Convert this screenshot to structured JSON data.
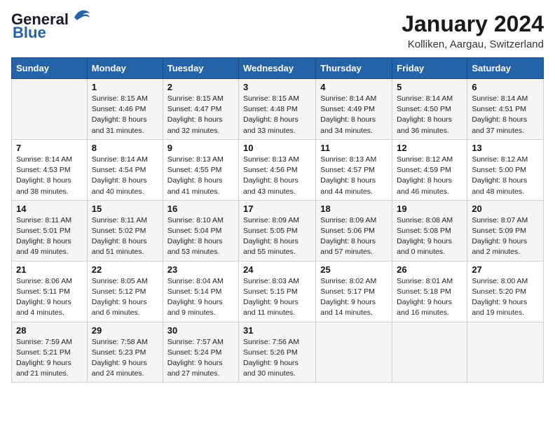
{
  "header": {
    "logo_line1": "General",
    "logo_line2": "Blue",
    "title": "January 2024",
    "subtitle": "Kolliken, Aargau, Switzerland"
  },
  "calendar": {
    "days_of_week": [
      "Sunday",
      "Monday",
      "Tuesday",
      "Wednesday",
      "Thursday",
      "Friday",
      "Saturday"
    ],
    "weeks": [
      [
        {
          "day": "",
          "info": ""
        },
        {
          "day": "1",
          "info": "Sunrise: 8:15 AM\nSunset: 4:46 PM\nDaylight: 8 hours\nand 31 minutes."
        },
        {
          "day": "2",
          "info": "Sunrise: 8:15 AM\nSunset: 4:47 PM\nDaylight: 8 hours\nand 32 minutes."
        },
        {
          "day": "3",
          "info": "Sunrise: 8:15 AM\nSunset: 4:48 PM\nDaylight: 8 hours\nand 33 minutes."
        },
        {
          "day": "4",
          "info": "Sunrise: 8:14 AM\nSunset: 4:49 PM\nDaylight: 8 hours\nand 34 minutes."
        },
        {
          "day": "5",
          "info": "Sunrise: 8:14 AM\nSunset: 4:50 PM\nDaylight: 8 hours\nand 36 minutes."
        },
        {
          "day": "6",
          "info": "Sunrise: 8:14 AM\nSunset: 4:51 PM\nDaylight: 8 hours\nand 37 minutes."
        }
      ],
      [
        {
          "day": "7",
          "info": "Sunrise: 8:14 AM\nSunset: 4:53 PM\nDaylight: 8 hours\nand 38 minutes."
        },
        {
          "day": "8",
          "info": "Sunrise: 8:14 AM\nSunset: 4:54 PM\nDaylight: 8 hours\nand 40 minutes."
        },
        {
          "day": "9",
          "info": "Sunrise: 8:13 AM\nSunset: 4:55 PM\nDaylight: 8 hours\nand 41 minutes."
        },
        {
          "day": "10",
          "info": "Sunrise: 8:13 AM\nSunset: 4:56 PM\nDaylight: 8 hours\nand 43 minutes."
        },
        {
          "day": "11",
          "info": "Sunrise: 8:13 AM\nSunset: 4:57 PM\nDaylight: 8 hours\nand 44 minutes."
        },
        {
          "day": "12",
          "info": "Sunrise: 8:12 AM\nSunset: 4:59 PM\nDaylight: 8 hours\nand 46 minutes."
        },
        {
          "day": "13",
          "info": "Sunrise: 8:12 AM\nSunset: 5:00 PM\nDaylight: 8 hours\nand 48 minutes."
        }
      ],
      [
        {
          "day": "14",
          "info": "Sunrise: 8:11 AM\nSunset: 5:01 PM\nDaylight: 8 hours\nand 49 minutes."
        },
        {
          "day": "15",
          "info": "Sunrise: 8:11 AM\nSunset: 5:02 PM\nDaylight: 8 hours\nand 51 minutes."
        },
        {
          "day": "16",
          "info": "Sunrise: 8:10 AM\nSunset: 5:04 PM\nDaylight: 8 hours\nand 53 minutes."
        },
        {
          "day": "17",
          "info": "Sunrise: 8:09 AM\nSunset: 5:05 PM\nDaylight: 8 hours\nand 55 minutes."
        },
        {
          "day": "18",
          "info": "Sunrise: 8:09 AM\nSunset: 5:06 PM\nDaylight: 8 hours\nand 57 minutes."
        },
        {
          "day": "19",
          "info": "Sunrise: 8:08 AM\nSunset: 5:08 PM\nDaylight: 9 hours\nand 0 minutes."
        },
        {
          "day": "20",
          "info": "Sunrise: 8:07 AM\nSunset: 5:09 PM\nDaylight: 9 hours\nand 2 minutes."
        }
      ],
      [
        {
          "day": "21",
          "info": "Sunrise: 8:06 AM\nSunset: 5:11 PM\nDaylight: 9 hours\nand 4 minutes."
        },
        {
          "day": "22",
          "info": "Sunrise: 8:05 AM\nSunset: 5:12 PM\nDaylight: 9 hours\nand 6 minutes."
        },
        {
          "day": "23",
          "info": "Sunrise: 8:04 AM\nSunset: 5:14 PM\nDaylight: 9 hours\nand 9 minutes."
        },
        {
          "day": "24",
          "info": "Sunrise: 8:03 AM\nSunset: 5:15 PM\nDaylight: 9 hours\nand 11 minutes."
        },
        {
          "day": "25",
          "info": "Sunrise: 8:02 AM\nSunset: 5:17 PM\nDaylight: 9 hours\nand 14 minutes."
        },
        {
          "day": "26",
          "info": "Sunrise: 8:01 AM\nSunset: 5:18 PM\nDaylight: 9 hours\nand 16 minutes."
        },
        {
          "day": "27",
          "info": "Sunrise: 8:00 AM\nSunset: 5:20 PM\nDaylight: 9 hours\nand 19 minutes."
        }
      ],
      [
        {
          "day": "28",
          "info": "Sunrise: 7:59 AM\nSunset: 5:21 PM\nDaylight: 9 hours\nand 21 minutes."
        },
        {
          "day": "29",
          "info": "Sunrise: 7:58 AM\nSunset: 5:23 PM\nDaylight: 9 hours\nand 24 minutes."
        },
        {
          "day": "30",
          "info": "Sunrise: 7:57 AM\nSunset: 5:24 PM\nDaylight: 9 hours\nand 27 minutes."
        },
        {
          "day": "31",
          "info": "Sunrise: 7:56 AM\nSunset: 5:26 PM\nDaylight: 9 hours\nand 30 minutes."
        },
        {
          "day": "",
          "info": ""
        },
        {
          "day": "",
          "info": ""
        },
        {
          "day": "",
          "info": ""
        }
      ]
    ]
  }
}
